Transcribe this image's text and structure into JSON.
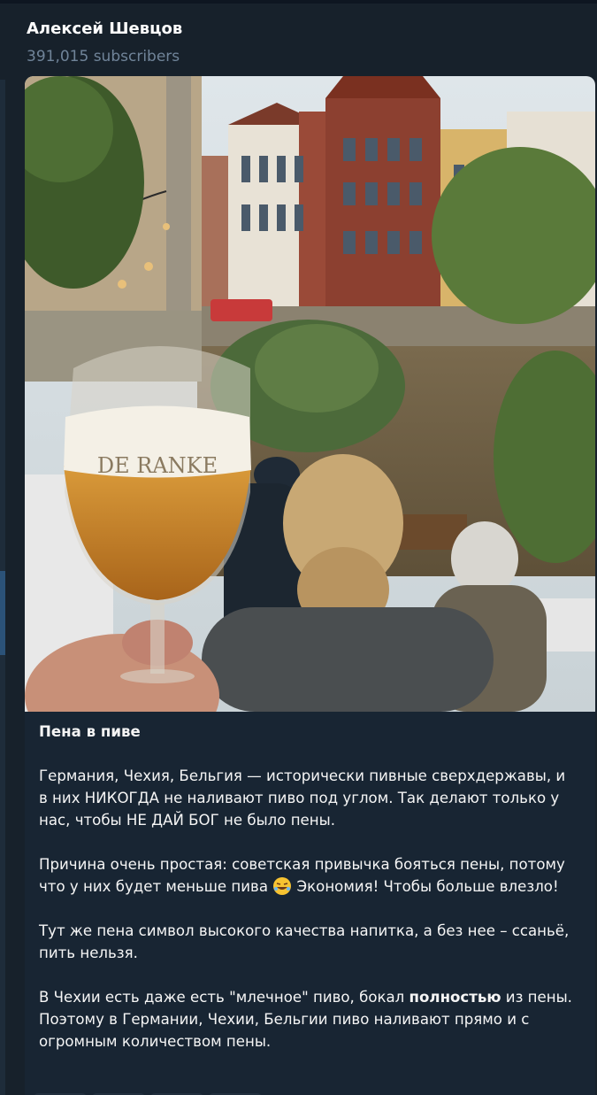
{
  "channel": {
    "name": "Алексей Шевцов",
    "subscribers": "391,015 subscribers"
  },
  "photo": {
    "icon": "beer-glass-photo",
    "glass_logo_text": "DE RANKE"
  },
  "post": {
    "title": "Пена в пиве",
    "p1": "Германия, Чехия, Бельгия — исторически пивные сверхдержавы, и в них НИКОГДА не наливают пиво под углом. Так делают только у нас, чтобы НЕ ДАЙ БОГ не было пены.",
    "p2_a": "Причина очень простая: советская привычка бояться пены, потому что у них будет меньше пива ",
    "p2_emoji": "rofl-emoji",
    "p2_b": " Экономия! Чтобы больше влезло!",
    "p3": "Тут же пена символ высокого качества напитка, а без нее – ссаньё, пить нельзя.",
    "p4_a": "В Чехии есть даже есть \"млечное\" пиво, бокал ",
    "p4_bold": "полностью",
    "p4_b": " из пены. Поэтому в Германии, Чехии, Бельгии пиво наливают прямо и с огромным количеством пены."
  },
  "colors": {
    "background": "#17212b",
    "bubble": "#182533",
    "muted_text": "#708499",
    "text": "#f5f5f5"
  }
}
